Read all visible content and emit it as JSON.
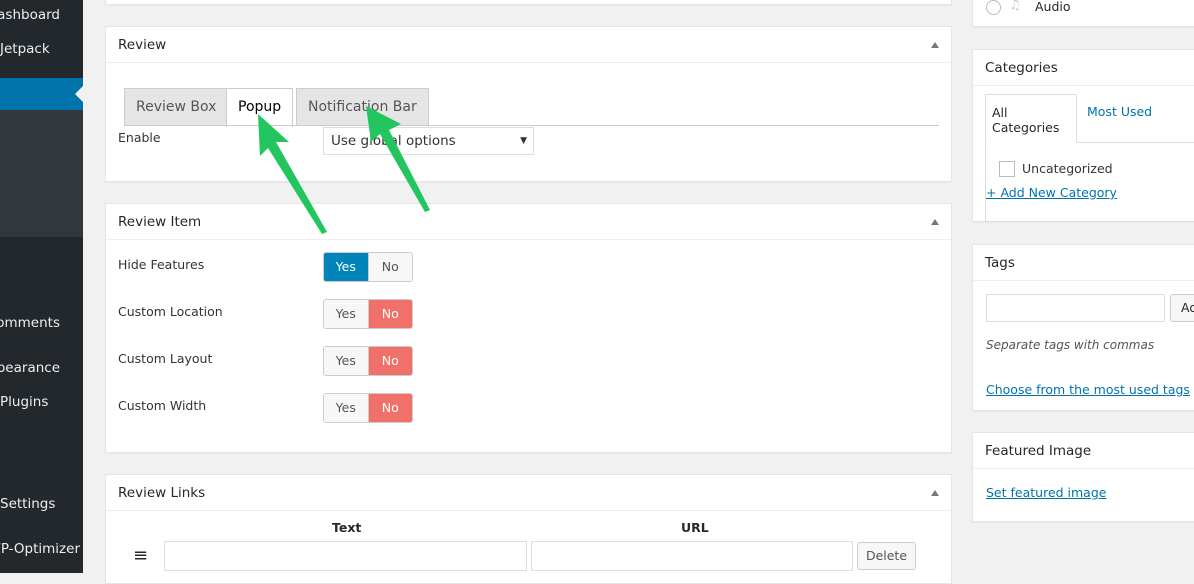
{
  "sidebar": {
    "items": [
      {
        "label": "Dashboard"
      },
      {
        "label": "Jetpack"
      },
      {
        "label": "Comments"
      },
      {
        "label": "Appearance"
      },
      {
        "label": "Plugins"
      },
      {
        "label": "Settings"
      },
      {
        "label": "WP-Optimizer"
      }
    ]
  },
  "review": {
    "title": "Review",
    "tabs": [
      {
        "label": "Review Box"
      },
      {
        "label": "Popup"
      },
      {
        "label": "Notification Bar"
      }
    ],
    "active_tab": "Popup",
    "enable_label": "Enable",
    "enable_value": "Use global options"
  },
  "review_item": {
    "title": "Review Item",
    "yes": "Yes",
    "no": "No",
    "rows": [
      {
        "label": "Hide Features",
        "value": "Yes"
      },
      {
        "label": "Custom Location",
        "value": "No"
      },
      {
        "label": "Custom Layout",
        "value": "No"
      },
      {
        "label": "Custom Width",
        "value": "No"
      }
    ]
  },
  "review_links": {
    "title": "Review Links",
    "col_text": "Text",
    "col_url": "URL",
    "delete": "Delete"
  },
  "format": {
    "audio": "Audio"
  },
  "categories": {
    "title": "Categories",
    "tab_all": "All Categories",
    "tab_most": "Most Used",
    "item": "Uncategorized",
    "add": "+ Add New Category"
  },
  "tags": {
    "title": "Tags",
    "add": "Add",
    "hint": "Separate tags with commas",
    "choose": "Choose from the most used tags"
  },
  "featured": {
    "title": "Featured Image",
    "set": "Set featured image"
  },
  "colors": {
    "accent": "#0073aa",
    "no": "#f0706a",
    "yes": "#0085ba",
    "arrow": "#22c55e"
  }
}
